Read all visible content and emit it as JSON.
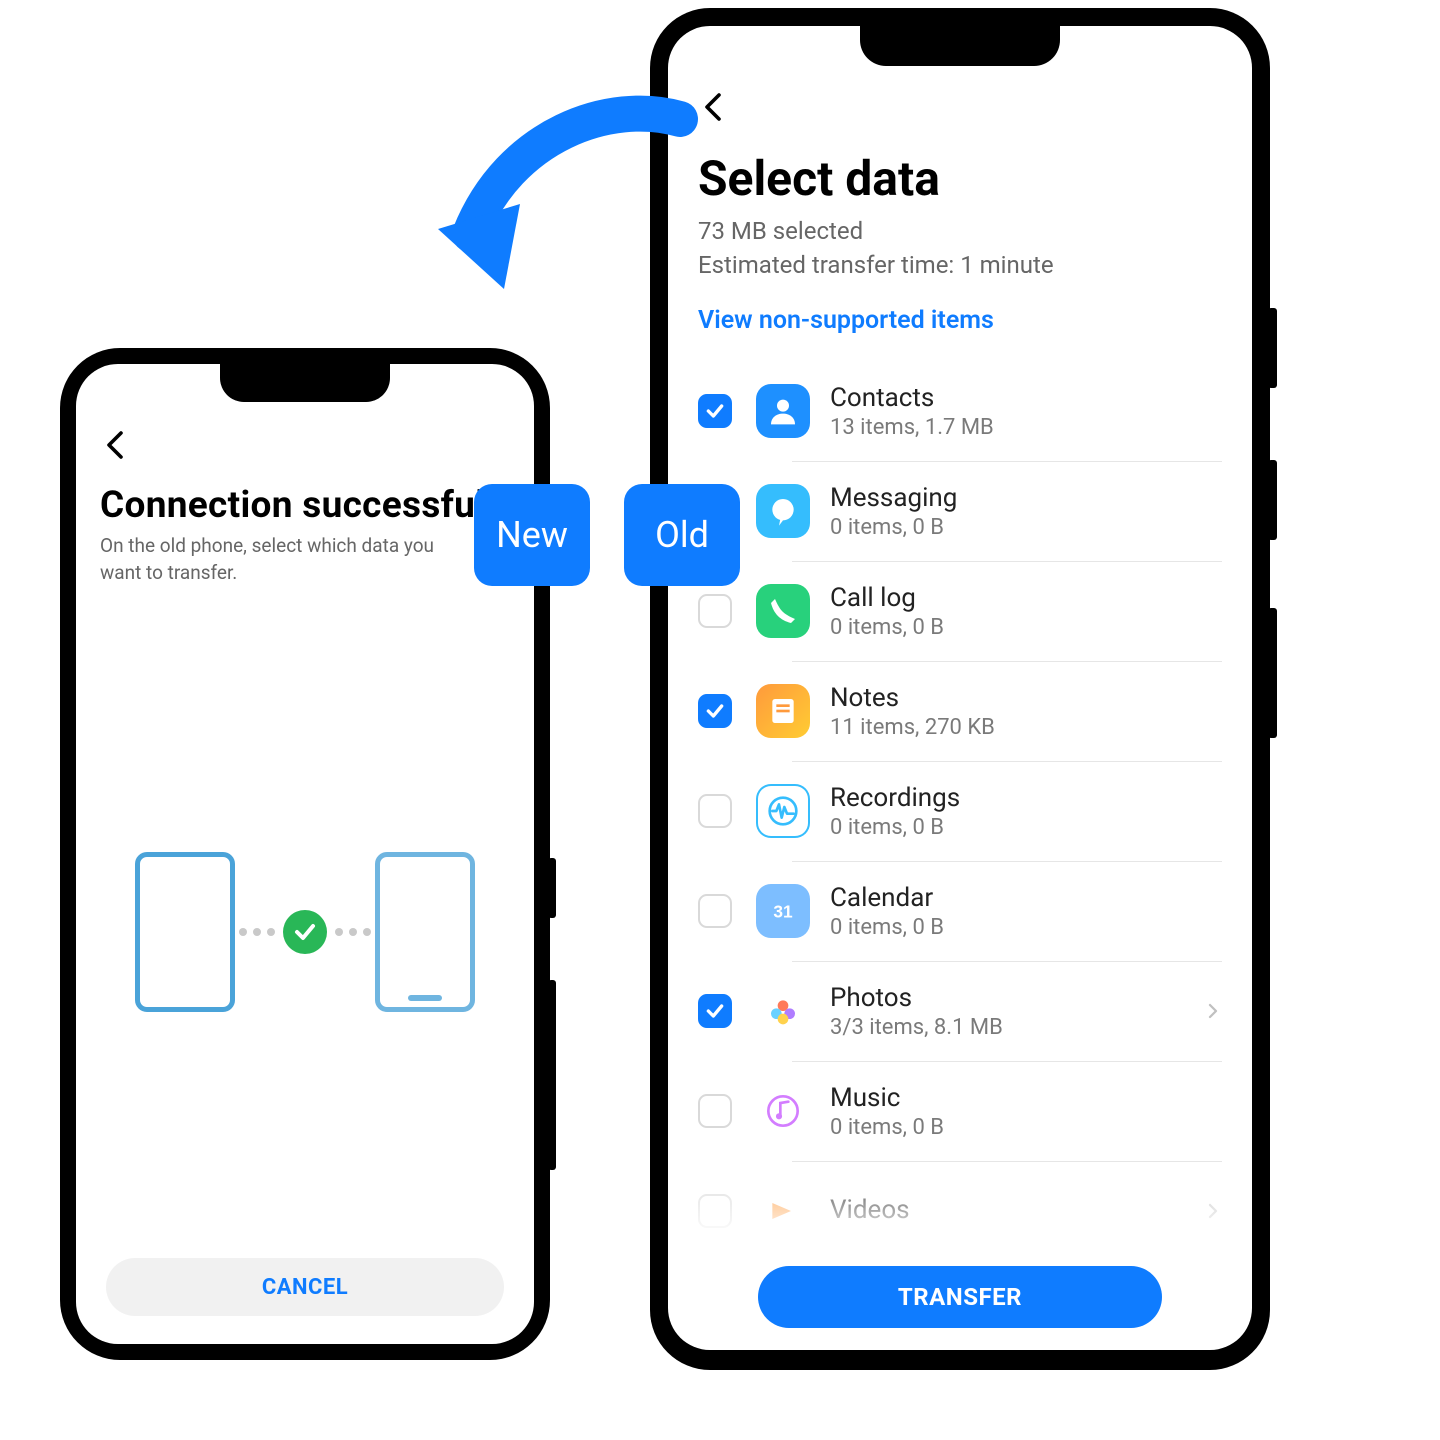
{
  "labels": {
    "new": "New",
    "old": "Old"
  },
  "new_phone": {
    "title": "Connection successful",
    "subtitle": "On the old phone, select which data you want to transfer.",
    "cancel": "CANCEL"
  },
  "old_phone": {
    "title": "Select data",
    "selected": "73 MB selected",
    "eta": "Estimated transfer time: 1 minute",
    "link": "View non-supported items",
    "transfer": "TRANSFER",
    "items": [
      {
        "title": "Contacts",
        "subtitle": "13 items, 1.7 MB",
        "checked": true,
        "icon": "contacts",
        "chevron": false
      },
      {
        "title": "Messaging",
        "subtitle": "0 items, 0 B",
        "checked": false,
        "icon": "messaging",
        "chevron": false
      },
      {
        "title": "Call log",
        "subtitle": "0 items, 0 B",
        "checked": false,
        "icon": "calllog",
        "chevron": false
      },
      {
        "title": "Notes",
        "subtitle": "11 items, 270 KB",
        "checked": true,
        "icon": "notes",
        "chevron": false
      },
      {
        "title": "Recordings",
        "subtitle": "0 items, 0 B",
        "checked": false,
        "icon": "recordings",
        "chevron": false
      },
      {
        "title": "Calendar",
        "subtitle": "0 items, 0 B",
        "checked": false,
        "icon": "calendar",
        "chevron": false
      },
      {
        "title": "Photos",
        "subtitle": "3/3 items, 8.1 MB",
        "checked": true,
        "icon": "photos",
        "chevron": true
      },
      {
        "title": "Music",
        "subtitle": "0 items, 0 B",
        "checked": false,
        "icon": "music",
        "chevron": false
      },
      {
        "title": "Videos",
        "subtitle": "",
        "checked": false,
        "icon": "videos",
        "chevron": true
      }
    ]
  }
}
